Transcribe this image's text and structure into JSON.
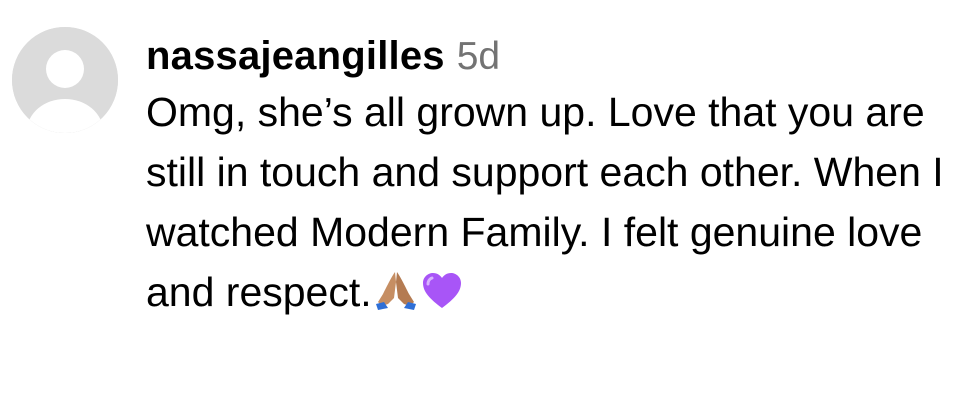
{
  "comment": {
    "username": "nassajeangilles",
    "timestamp": "5d",
    "text": "Omg, she’s all grown up. Love that you are still in touch and support each other. When I watched Modern Family. I felt genuine love and respect.",
    "emojis": [
      "folded-hands-emoji",
      "purple-heart-emoji"
    ]
  },
  "colors": {
    "avatar_bg": "#dbdbdb",
    "avatar_figure": "#ffffff",
    "timestamp": "#737373",
    "text": "#000000",
    "purple_heart": "#a855f7"
  }
}
